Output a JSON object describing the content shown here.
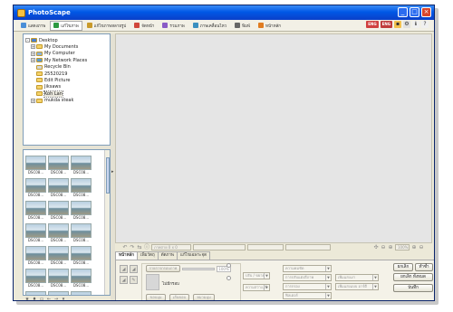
{
  "window": {
    "title": "PhotoScape"
  },
  "tabs": [
    {
      "label": "แสดงภาพ",
      "color": "#4a8fd8"
    },
    {
      "label": "แก้ไขภาพ",
      "color": "#2e9a42"
    },
    {
      "label": "แก้ไขภาพหลายรูป",
      "color": "#c99a2a"
    },
    {
      "label": "จัดหน้า",
      "color": "#d0463a"
    },
    {
      "label": "รวมภาพ",
      "color": "#8a5bc6"
    },
    {
      "label": "ภาพเคลื่อนไหว",
      "color": "#3a8fc0"
    },
    {
      "label": "พิมพ์",
      "color": "#666666"
    },
    {
      "label": "หน้าหลัก",
      "color": "#e07c20"
    }
  ],
  "tools": {
    "badge1": "ENG",
    "badge2": "ENG"
  },
  "tree": [
    {
      "label": "Desktop",
      "level": 0,
      "exp": "-",
      "kind": "desktop"
    },
    {
      "label": "My Documents",
      "level": 1,
      "exp": "+",
      "kind": "docs"
    },
    {
      "label": "My Computer",
      "level": 1,
      "exp": "+",
      "kind": "computer"
    },
    {
      "label": "My Network Places",
      "level": 1,
      "exp": "+",
      "kind": "network"
    },
    {
      "label": "Recycle Bin",
      "level": 1,
      "exp": "",
      "kind": "bin"
    },
    {
      "label": "25520219",
      "level": 1,
      "exp": "",
      "kind": "folder"
    },
    {
      "label": "Edit Picture",
      "level": 1,
      "exp": "",
      "kind": "folder"
    },
    {
      "label": "Jiksaws",
      "level": 1,
      "exp": "",
      "kind": "folder"
    },
    {
      "label": "Koh Lan",
      "level": 1,
      "exp": "",
      "kind": "folder",
      "selected": true
    },
    {
      "label": "mukda steak",
      "level": 1,
      "exp": "+",
      "kind": "folder"
    }
  ],
  "thumbnails": [
    "DSC08...",
    "DSC08...",
    "DSC08...",
    "DSC08...",
    "DSC08...",
    "DSC08...",
    "DSC08...",
    "DSC08...",
    "DSC08...",
    "DSC08...",
    "DSC08...",
    "DSC08...",
    "DSC08...",
    "DSC08...",
    "DSC08...",
    "DSC08...",
    "DSC08...",
    "DSC08...",
    "DSC08...",
    "DSC08...",
    "DSC08..."
  ],
  "toolbar2": {
    "filename": "ภาพถ่าย 0 x 0",
    "zoom": "100%"
  },
  "edit_tabs": [
    "หน้าหลัก",
    "เพิ่มวัตถุ",
    "ตัดภาพ",
    "แก้ไขเฉพาะจุด"
  ],
  "edit": {
    "frame_select": "รายการกรอบภาพ",
    "pct": "100%",
    "no_frame": "ไม่มีกรอบ",
    "btn_a": "ขอบมุม",
    "btn_b": "เส้นขอบ",
    "btn_c": "หมวมมุม",
    "sel1": "ปรับ / ขยาย",
    "sel2": "ความสว่าง, สี",
    "sel3": "ความคมชัด",
    "sel4": "การปรับแต่งสีภาพ",
    "sel5": "การกรอง",
    "sel6": "ฟิลเตอร์",
    "sel7": "เพิ่มแสงเงา",
    "sel8": "เพิ่มแสงแบบ อาร์ตี"
  },
  "actions": {
    "undo": "ยกเลิก",
    "redo": "ทำซ้ำ",
    "undo_all": "ยกเลิก ทั้งหมด",
    "save": "บันทึก"
  }
}
